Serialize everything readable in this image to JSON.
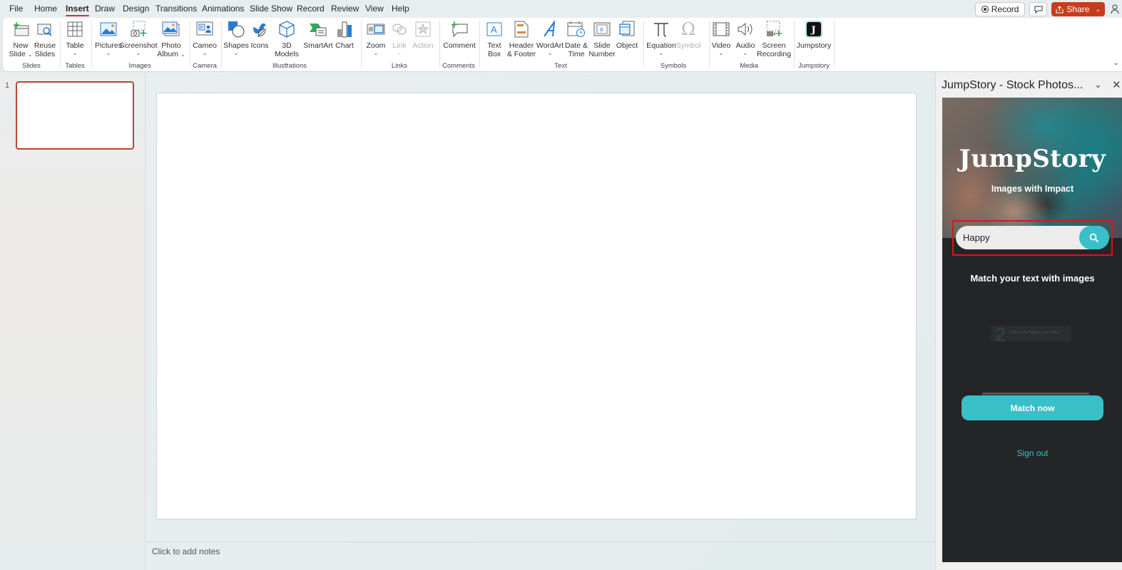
{
  "menu": {
    "tabs": [
      {
        "label": "File"
      },
      {
        "label": "Home"
      },
      {
        "label": "Insert",
        "active": true
      },
      {
        "label": "Draw"
      },
      {
        "label": "Design"
      },
      {
        "label": "Transitions"
      },
      {
        "label": "Animations"
      },
      {
        "label": "Slide Show"
      },
      {
        "label": "Record"
      },
      {
        "label": "Review"
      },
      {
        "label": "View"
      },
      {
        "label": "Help"
      }
    ],
    "record_button": "Record",
    "share_button": "Share"
  },
  "ribbon": {
    "buttons": {
      "new_slide": [
        "New",
        "Slide"
      ],
      "reuse_slides": [
        "Reuse",
        "Slides"
      ],
      "table": [
        "Table"
      ],
      "pictures": [
        "Pictures"
      ],
      "screenshot": [
        "Screenshot"
      ],
      "photo_album": [
        "Photo",
        "Album"
      ],
      "cameo": [
        "Cameo"
      ],
      "shapes": [
        "Shapes"
      ],
      "icons": [
        "Icons"
      ],
      "models_3d": [
        "3D",
        "Models"
      ],
      "smartart": [
        "SmartArt"
      ],
      "chart": [
        "Chart"
      ],
      "zoom": [
        "Zoom"
      ],
      "link": [
        "Link"
      ],
      "action": [
        "Action"
      ],
      "comment": [
        "Comment"
      ],
      "text_box": [
        "Text",
        "Box"
      ],
      "header_footer": [
        "Header",
        "& Footer"
      ],
      "wordart": [
        "WordArt"
      ],
      "date_time": [
        "Date &",
        "Time"
      ],
      "slide_number": [
        "Slide",
        "Number"
      ],
      "object": [
        "Object"
      ],
      "equation": [
        "Equation"
      ],
      "symbol": [
        "Symbol"
      ],
      "video": [
        "Video"
      ],
      "audio": [
        "Audio"
      ],
      "screen_recording": [
        "Screen",
        "Recording"
      ],
      "jumpstory": [
        "Jumpstory"
      ]
    },
    "groups": {
      "slides": "Slides",
      "tables": "Tables",
      "images": "Images",
      "camera": "Camera",
      "illustrations": "Illustrations",
      "links": "Links",
      "comments": "Comments",
      "text": "Text",
      "symbols": "Symbols",
      "media": "Media",
      "jumpstory": "Jumpstory"
    }
  },
  "thumbnails": {
    "slides": [
      {
        "number": "1",
        "selected": true
      }
    ]
  },
  "editor": {
    "notes_placeholder": "Click to add notes"
  },
  "taskpane": {
    "title": "JumpStory - Stock Photos...",
    "addin": {
      "logo": "JumpStory",
      "tagline": "Images with Impact",
      "search_value": "Happy",
      "match_title": "Match your text with images",
      "step_number": "2",
      "step_text": "Click on the \"Match now\" button",
      "match_button": "Match now",
      "sign_out": "Sign out"
    }
  },
  "colors": {
    "accent": "#c43e1c",
    "addin_teal": "#38bfc8",
    "addin_bg": "#242527",
    "highlight_red": "#d9161c"
  }
}
